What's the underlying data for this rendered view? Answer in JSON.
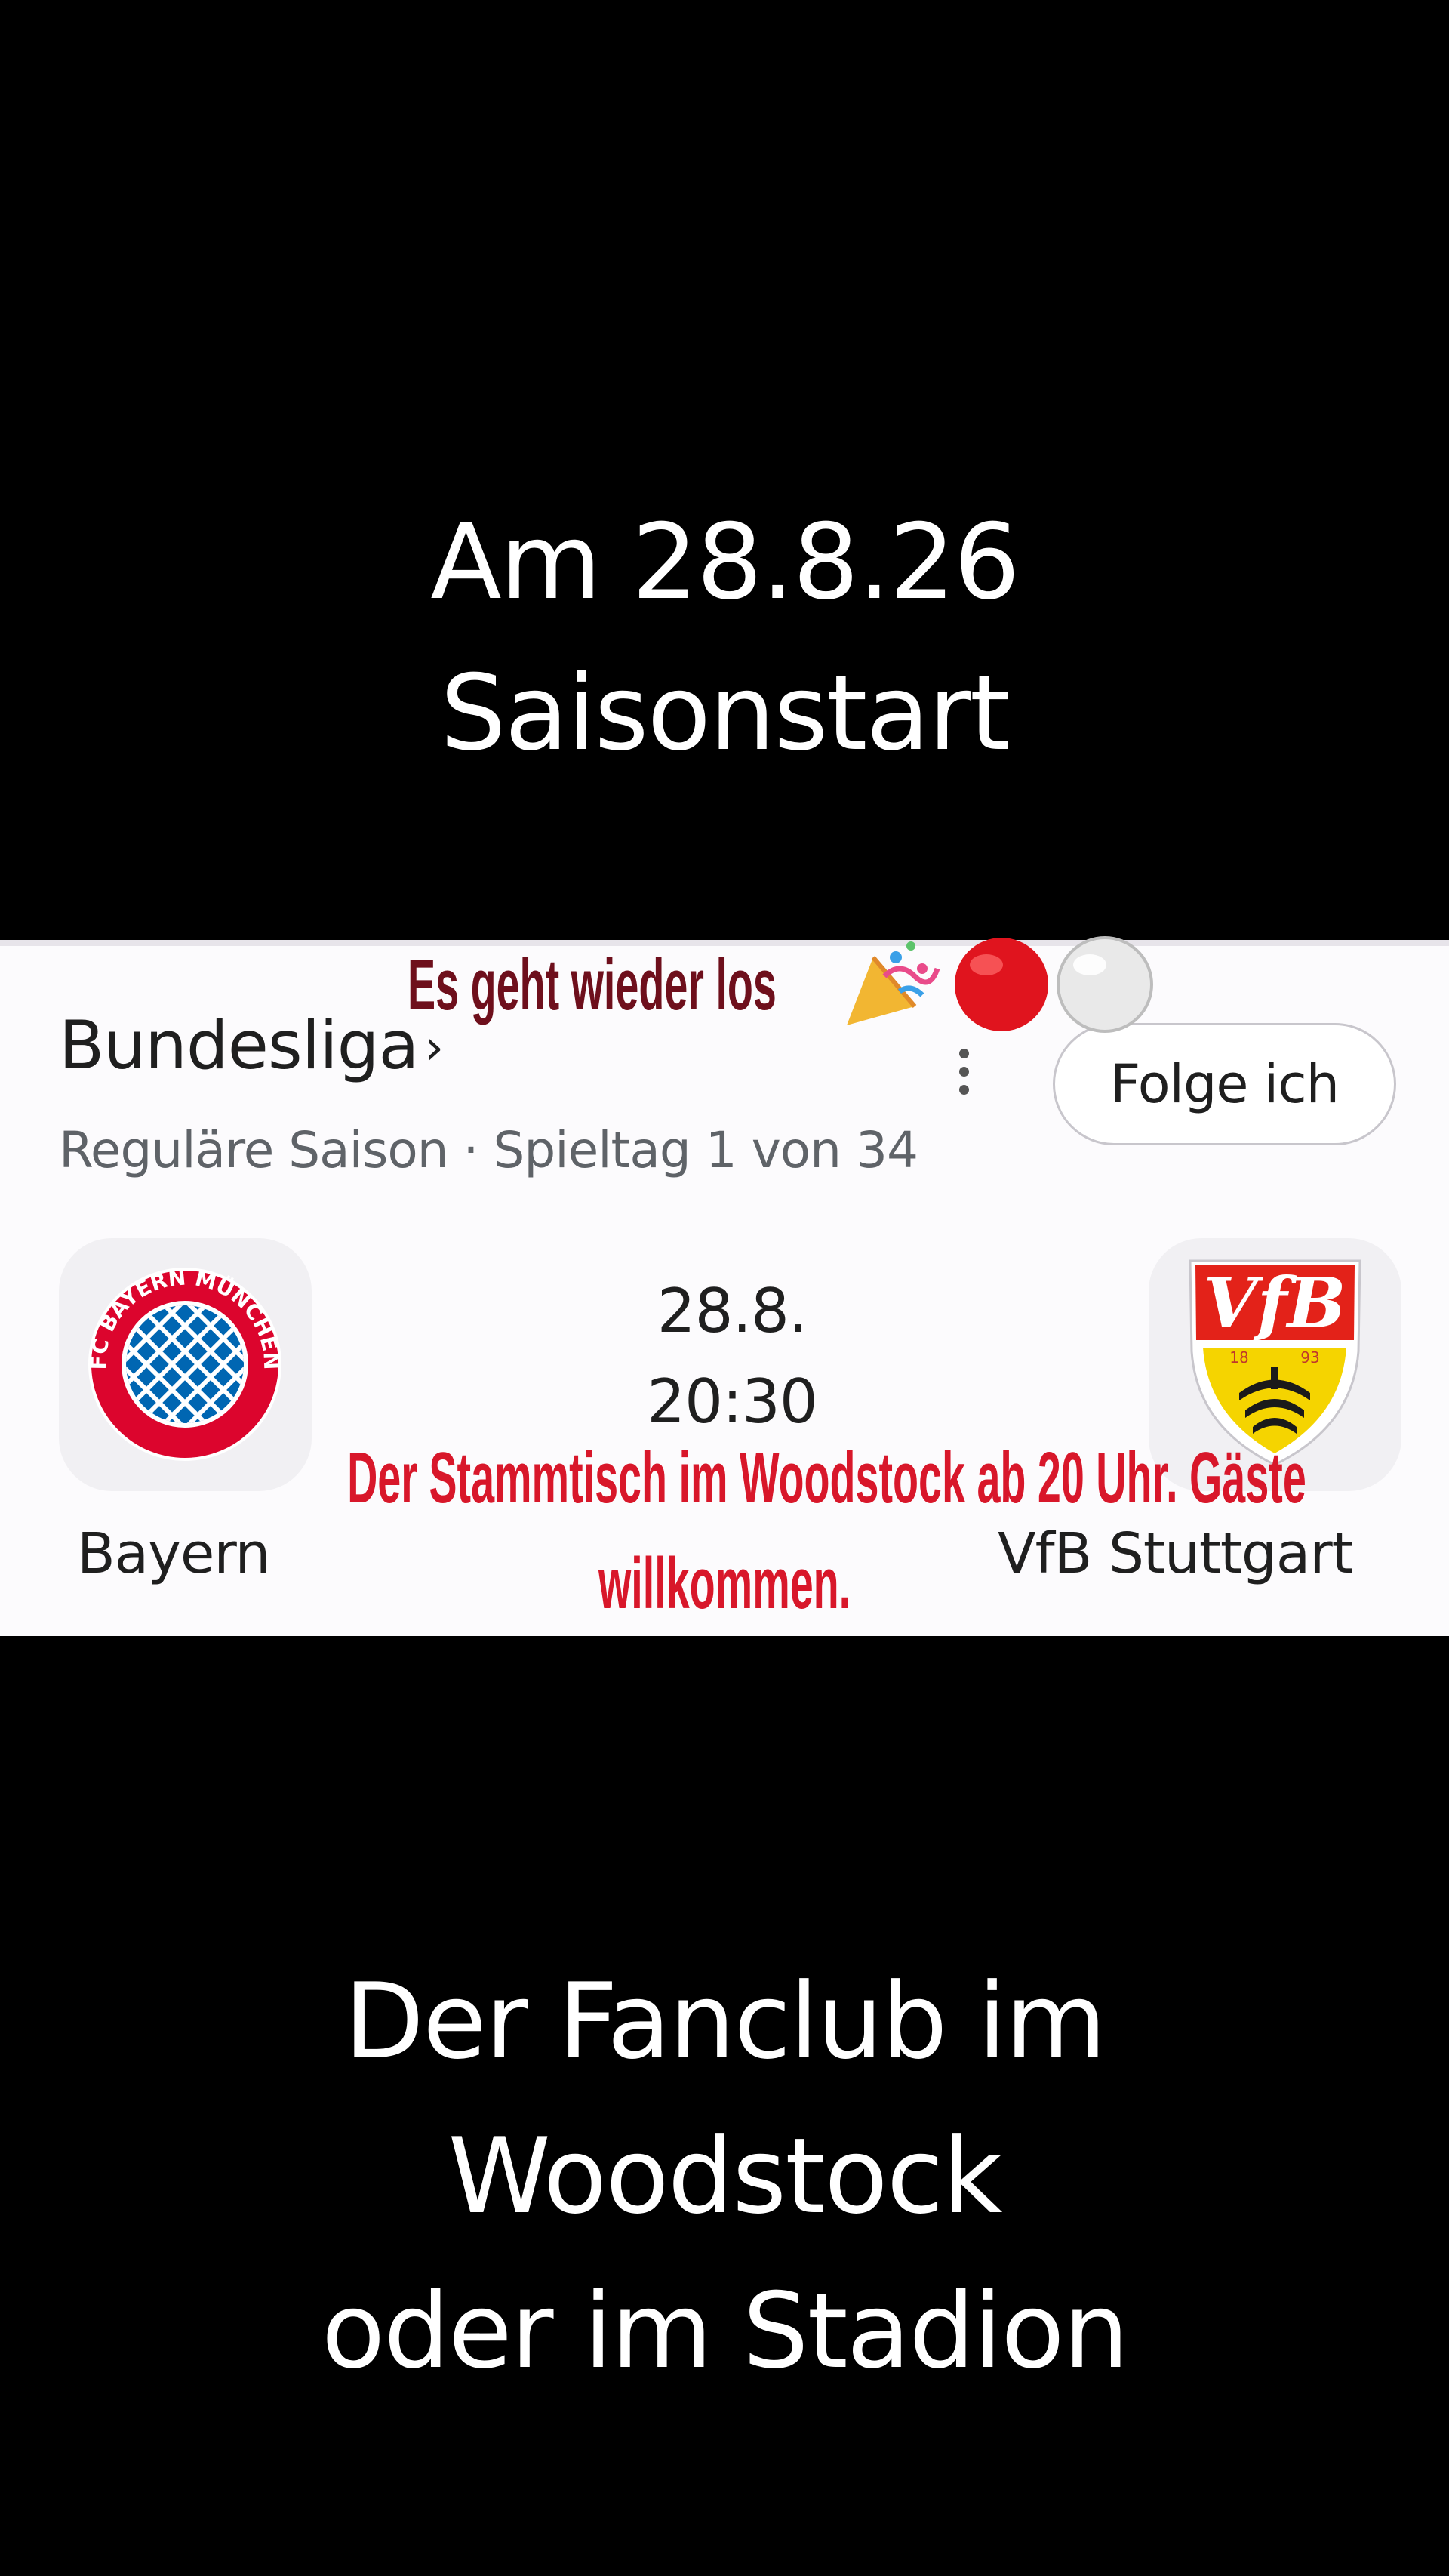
{
  "top_caption": {
    "line1": "Am 28.8.26",
    "line2": "Saisonstart"
  },
  "card": {
    "league_title": "Bundesliga",
    "chevron": "›",
    "subtitle": "Reguläre Saison · Spieltag 1 von 34",
    "more_icon": "more-vertical-icon",
    "follow_label": "Folge ich",
    "match": {
      "date": "28.8.",
      "time": "20:30",
      "home_team": "Bayern",
      "away_team": "VfB Stuttgart",
      "home_logo": "fc-bayern-muenchen-logo",
      "home_logo_text": "FC BAYERN MÜNCHEN",
      "away_logo": "vfb-stuttgart-logo",
      "away_logo_text": "VfB",
      "away_logo_year_left": "18",
      "away_logo_year_right": "93"
    }
  },
  "overlay": {
    "headline": "Es geht wieder los",
    "emojis": [
      "party-popper-emoji",
      "red-circle-emoji",
      "white-circle-emoji"
    ],
    "note_line1": "Der Stammtisch im Woodstock ab 20 Uhr. Gäste",
    "note_line2": "willkommen."
  },
  "bottom_caption": {
    "line1": "Der Fanclub im",
    "line2": "Woodstock",
    "line3": "oder im Stadion"
  },
  "colors": {
    "background": "#000000",
    "card": "#fcfbfd",
    "headline": "#6e0f1c",
    "note": "#d8172a",
    "bayern_red": "#dc052d",
    "bayern_blue": "#0066b2",
    "vfb_red": "#e32219",
    "vfb_yellow": "#f5d400"
  }
}
